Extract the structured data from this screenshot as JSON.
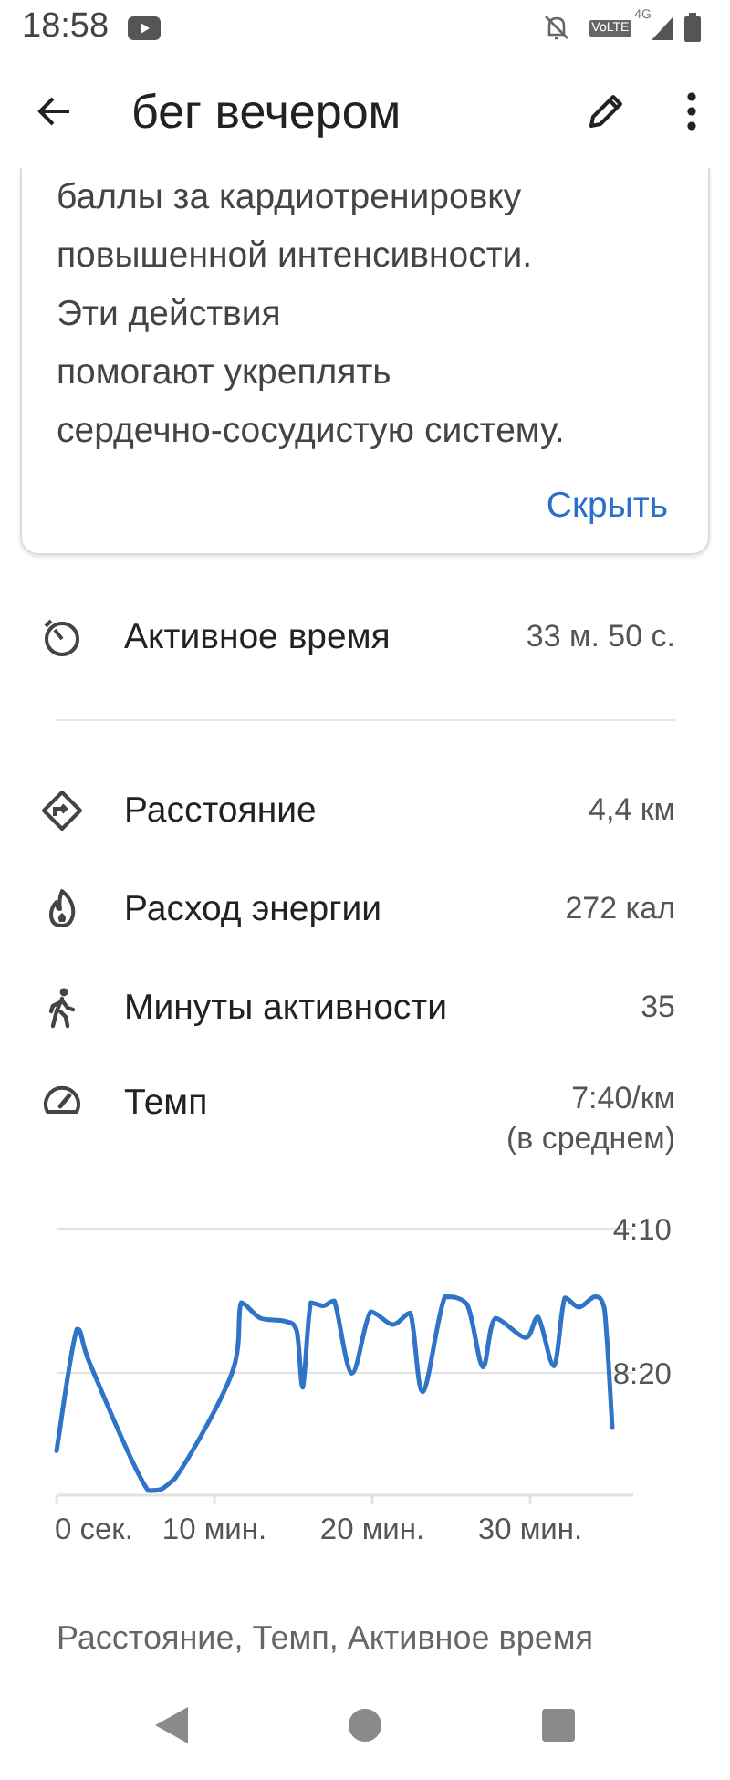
{
  "status_bar": {
    "time": "18:58",
    "volte": "VoLTE",
    "network": "4G"
  },
  "app_bar": {
    "title": "бег вечером"
  },
  "info_card": {
    "lines": [
      "баллы за кардиотренировку",
      "повышенной интенсивности.",
      "Эти действия",
      "помогают укреплять",
      "сердечно-сосудистую систему."
    ],
    "action": "Скрыть"
  },
  "active_time": {
    "label": "Активное время",
    "value": "33 м. 50 с."
  },
  "metrics": [
    {
      "kind": "distance",
      "label": "Расстояние",
      "value": "4,4 км"
    },
    {
      "kind": "energy",
      "label": "Расход энергии",
      "value": "272 кал"
    },
    {
      "kind": "minutes",
      "label": "Минуты активности",
      "value": "35"
    },
    {
      "kind": "pace",
      "label": "Темп",
      "value": "7:40/км",
      "note": "(в среднем)"
    }
  ],
  "pace_chart": {
    "chart_data": {
      "type": "line",
      "x": [
        0,
        1.3,
        2.2,
        5.8,
        7.5,
        11.1,
        11.7,
        12.9,
        14.4,
        15.2,
        15.6,
        16.1,
        16.9,
        17.6,
        18.7,
        19.9,
        21.3,
        22.4,
        23.2,
        24.6,
        26.0,
        27.0,
        27.8,
        29.7,
        30.5,
        31.5,
        32.2,
        33.1,
        34.1,
        34.7,
        35.2
      ],
      "series": [
        {
          "color": "#2f74c6",
          "values": [
            635,
            424,
            490,
            704,
            683,
            501,
            378,
            405,
            410,
            426,
            525,
            378,
            384,
            375,
            501,
            394,
            416,
            396,
            533,
            368,
            381,
            490,
            405,
            439,
            403,
            488,
            370,
            386,
            368,
            389,
            595
          ]
        }
      ],
      "xlim": [
        0,
        36.3
      ],
      "ylim": [
        712,
        250
      ],
      "xticks": [
        {
          "value": 0,
          "label": "0 сек."
        },
        {
          "value": 10,
          "label": "10 мин."
        },
        {
          "value": 20,
          "label": "20 мин."
        },
        {
          "value": 30,
          "label": "30 мин."
        }
      ],
      "yticks": [
        {
          "value": 250,
          "label": "4:10"
        },
        {
          "value": 500,
          "label": "8:20"
        }
      ]
    }
  },
  "next_section": {
    "text": "Расстояние, Темп, Активное время"
  }
}
